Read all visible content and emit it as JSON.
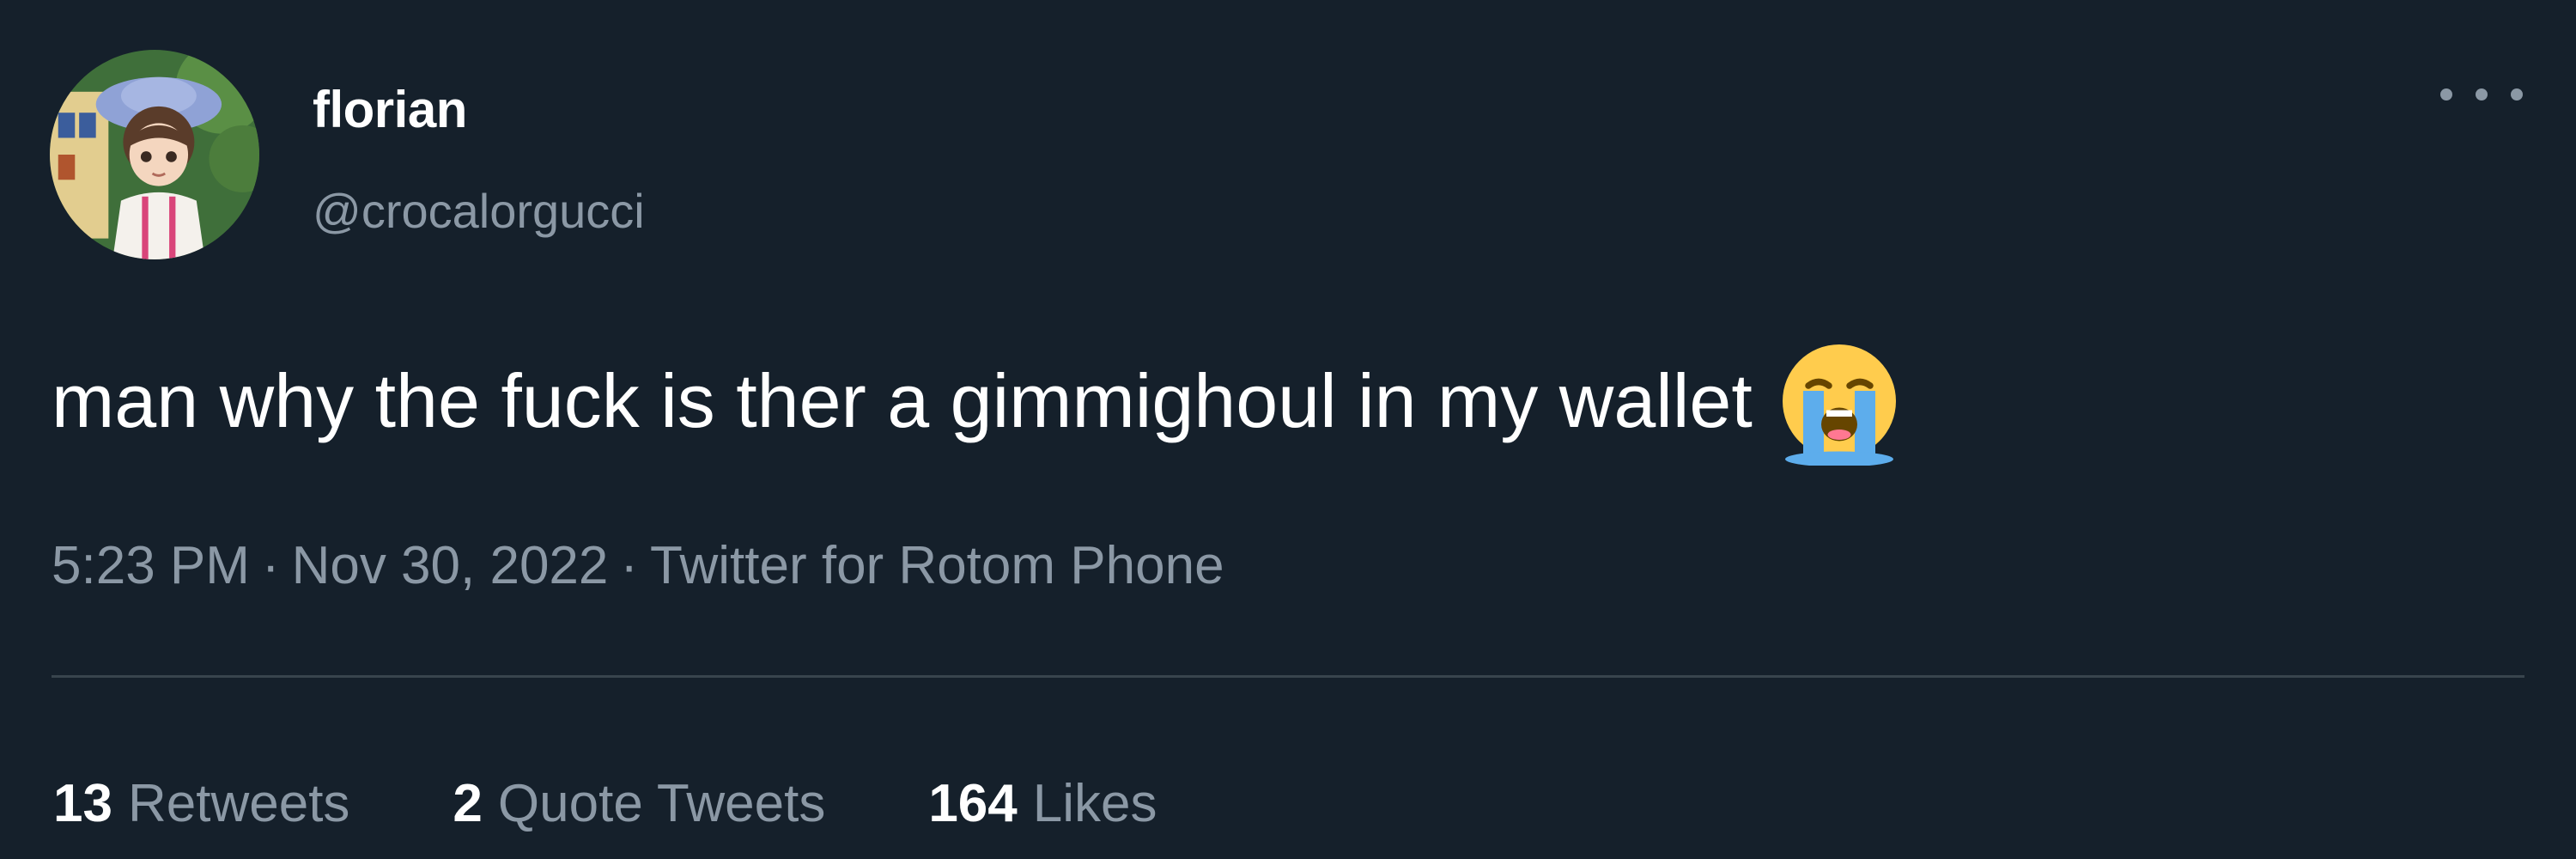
{
  "user": {
    "display_name": "florian",
    "handle": "@crocalorgucci",
    "avatar_icon": "anime-avatar"
  },
  "tweet": {
    "text": "man why the fuck is ther a gimmighoul in my wallet",
    "emoji_icon": "loudly-crying-face-icon",
    "time": "5:23 PM",
    "date": "Nov 30, 2022",
    "source": "Twitter for Rotom Phone",
    "separator": "·"
  },
  "stats": {
    "retweets_count": "13",
    "retweets_label": "Retweets",
    "quotes_count": "2",
    "quotes_label": "Quote Tweets",
    "likes_count": "164",
    "likes_label": "Likes"
  },
  "colors": {
    "background": "#15202b",
    "primary_text": "#ffffff",
    "secondary_text": "#8b98a5",
    "divider": "#38444d"
  }
}
